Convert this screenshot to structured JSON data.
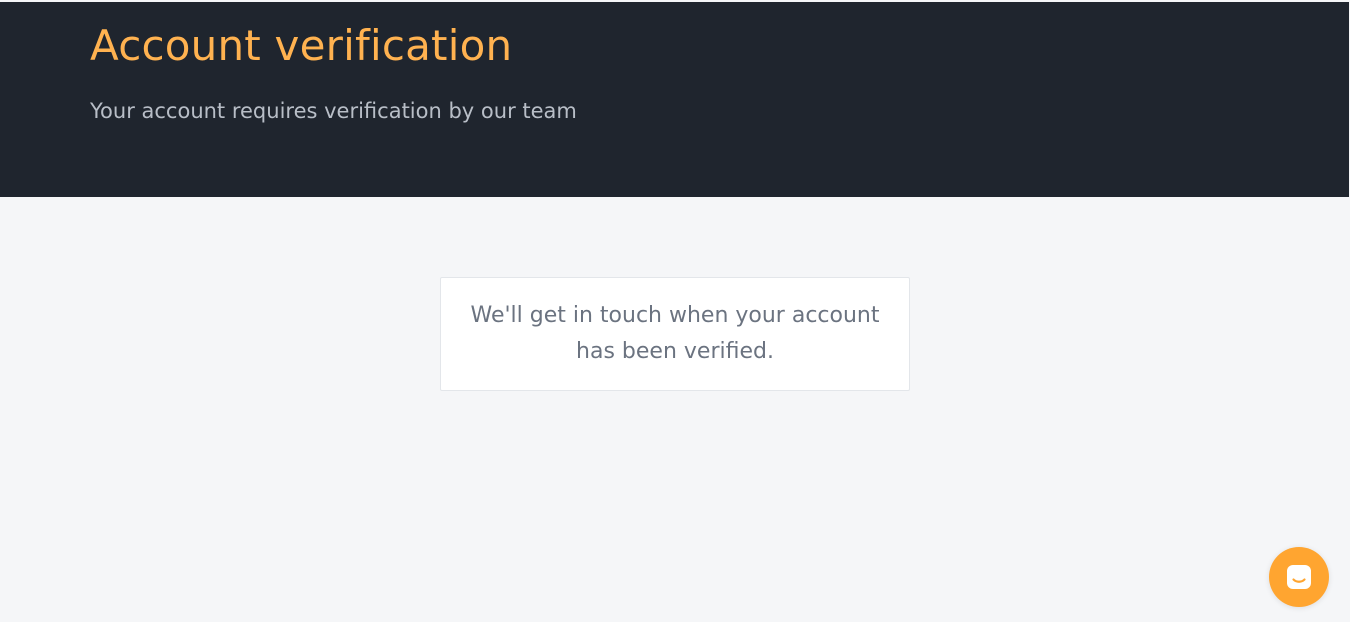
{
  "header": {
    "title": "Account verification",
    "subtitle": "Your account requires verification by our team"
  },
  "main": {
    "message": "We'll get in touch when your account has been verified."
  },
  "chat_launcher": {
    "icon": "chat-icon",
    "color": "#ffa530"
  },
  "colors": {
    "header_background": "#1f252e",
    "title": "#ffb250",
    "page_background": "#f5f6f8"
  }
}
